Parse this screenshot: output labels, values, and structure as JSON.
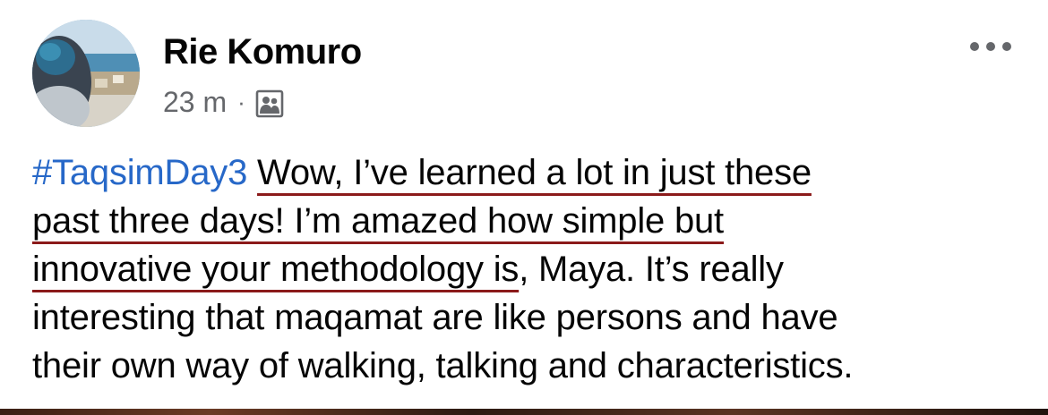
{
  "post": {
    "author": "Rie Komuro",
    "time": "23 m",
    "separator": "·",
    "audience_icon": "group-photo-icon",
    "more_icon": "more-options-icon",
    "text_lines": [
      [
        {
          "text": "#TaqsimDay3",
          "kind": "hashtag"
        },
        {
          "text": " ",
          "kind": "plain"
        },
        {
          "text": "Wow, I’ve learned a lot in just these",
          "kind": "underline"
        }
      ],
      [
        {
          "text": "past three days! I’m amazed how simple but",
          "kind": "underline"
        }
      ],
      [
        {
          "text": "innovative your methodology is",
          "kind": "underline"
        },
        {
          "text": ", Maya. It’s really",
          "kind": "plain"
        }
      ],
      [
        {
          "text": "interesting that maqamat are like persons and have",
          "kind": "plain"
        }
      ],
      [
        {
          "text": "their own way of walking, talking and characteristics.",
          "kind": "plain"
        }
      ]
    ]
  },
  "colors": {
    "hashtag": "#2768c8",
    "underline": "#8b1a1a",
    "meta": "#65676b",
    "text": "#050505"
  }
}
